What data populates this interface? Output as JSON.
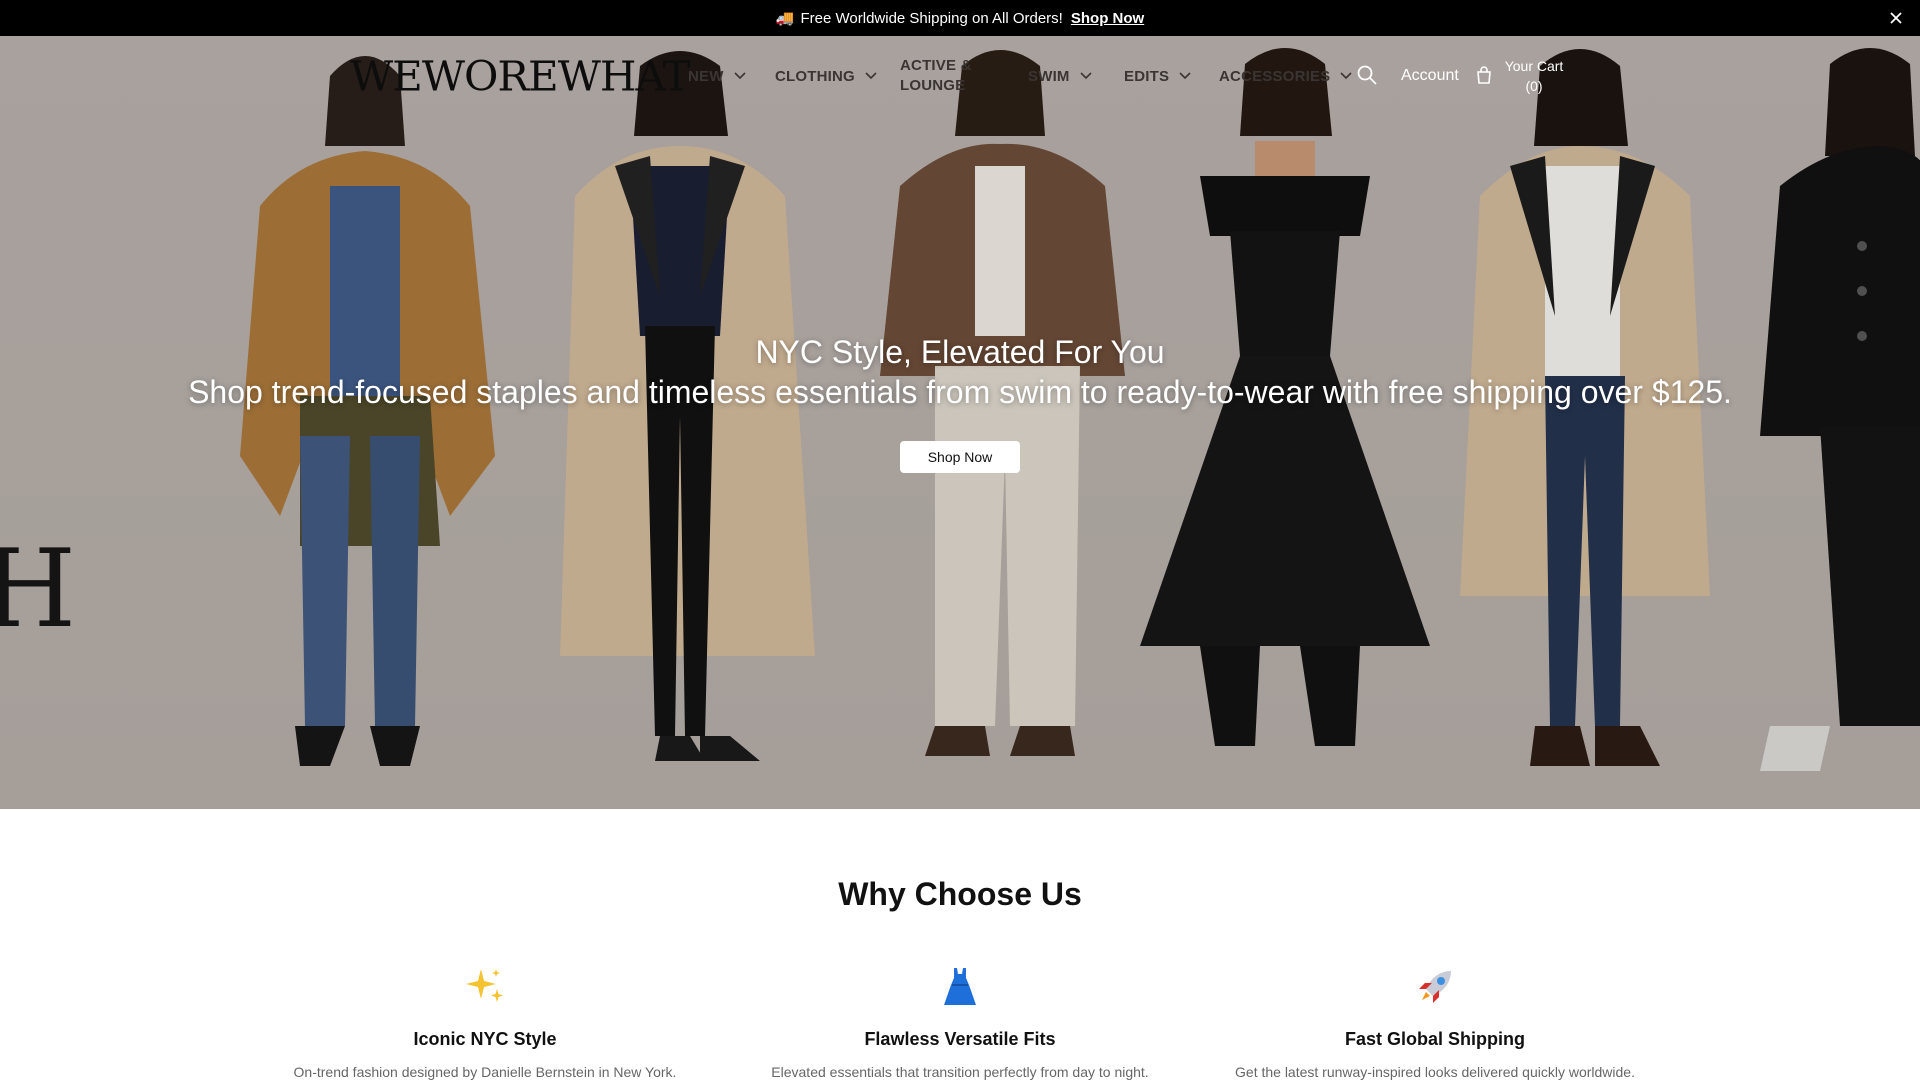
{
  "announcement": {
    "text": "Free Worldwide Shipping on All Orders!",
    "link_label": "Shop Now",
    "icon": "truck-icon",
    "close_icon": "close-icon"
  },
  "header": {
    "logo": "WEWOREWHAT",
    "nav": [
      {
        "label": "NEW",
        "has_dropdown": true
      },
      {
        "label": "CLOTHING",
        "has_dropdown": true
      },
      {
        "label": "ACTIVE & LOUNGE",
        "has_dropdown": false
      },
      {
        "label": "SWIM",
        "has_dropdown": true
      },
      {
        "label": "EDITS",
        "has_dropdown": true
      },
      {
        "label": "ACCESSORIES",
        "has_dropdown": true
      }
    ],
    "search_icon": "search-icon",
    "account_label": "Account",
    "cart_icon": "bag-icon",
    "cart_label": "Your Cart",
    "cart_count": "(0)"
  },
  "hero": {
    "title": "NYC Style, Elevated For You",
    "subtitle": "Shop trend-focused staples and timeless essentials from swim to ready-to-wear with free shipping over $125.",
    "button_label": "Shop Now",
    "background_letter": "H"
  },
  "why": {
    "title": "Why Choose Us",
    "features": [
      {
        "icon": "sparkles-icon",
        "title": "Iconic NYC Style",
        "text": "On-trend fashion designed by Danielle Bernstein in New York."
      },
      {
        "icon": "dress-icon",
        "title": "Flawless Versatile Fits",
        "text": "Elevated essentials that transition perfectly from day to night."
      },
      {
        "icon": "rocket-icon",
        "title": "Fast Global Shipping",
        "text": "Get the latest runway-inspired looks delivered quickly worldwide."
      }
    ]
  },
  "colors": {
    "announcement_bg": "#000000",
    "hero_bg": "#b3aba6",
    "nav_text": "#3a3533",
    "accent_dress": "#1e6fd9"
  }
}
